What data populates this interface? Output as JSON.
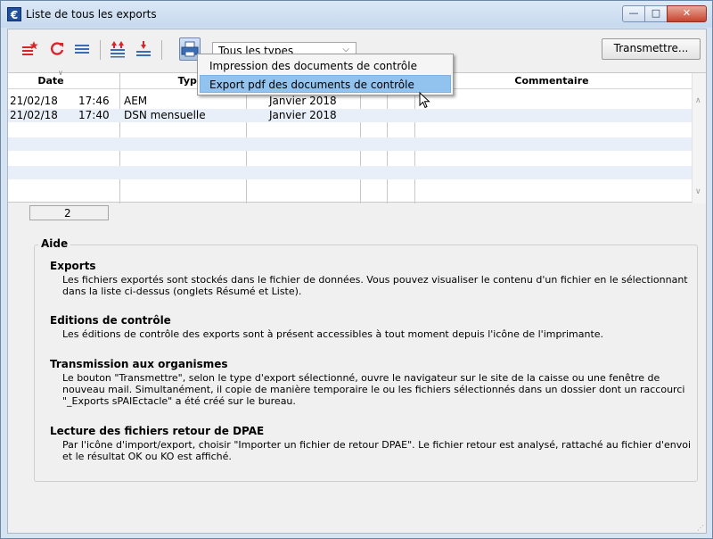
{
  "window": {
    "title": "Liste de tous les exports",
    "app_icon": "€",
    "minimize_glyph": "—",
    "maximize_glyph": "□",
    "close_glyph": "✕"
  },
  "toolbar": {
    "icons": [
      "new-star-icon",
      "refresh-icon",
      "list-icon",
      "sort-up-icon",
      "sort-down-icon",
      "printer-icon"
    ],
    "type_filter_value": "Tous les types",
    "transmit_label": "Transmettre..."
  },
  "menu": {
    "items": [
      {
        "label": "Impression des documents de contrôle",
        "highlighted": false
      },
      {
        "label": "Export pdf des documents de contrôle",
        "highlighted": true
      }
    ]
  },
  "table": {
    "headers": [
      "Date",
      "Type",
      "",
      "",
      "",
      "Commentaire"
    ],
    "rows": [
      {
        "date": "21/02/18",
        "time": "17:46",
        "type": "AEM",
        "period": "Janvier 2018"
      },
      {
        "date": "21/02/18",
        "time": "17:40",
        "type": "DSN mensuelle",
        "period": "Janvier 2018"
      }
    ],
    "count": "2"
  },
  "help": {
    "title": "Aide",
    "sections": [
      {
        "heading": "Exports",
        "text": "Les fichiers exportés sont stockés dans le fichier de données. Vous pouvez visualiser le contenu d'un fichier en le sélectionnant dans la liste ci-dessus (onglets Résumé et Liste)."
      },
      {
        "heading": "Editions de contrôle",
        "text": "Les éditions de contrôle des exports sont à présent accessibles à tout moment depuis l'icône de l'imprimante."
      },
      {
        "heading": "Transmission aux organismes",
        "text": "Le bouton \"Transmettre\", selon le type d'export sélectionné, ouvre le navigateur sur le site de la caisse ou une fenêtre de nouveau mail. Simultanément, il copie de manière temporaire le ou les fichiers sélectionnés dans un dossier dont un raccourci \"_Exports sPAIEctacle\" a été créé sur le bureau."
      },
      {
        "heading": "Lecture des fichiers retour de DPAE",
        "text": "Par l'icône d'import/export, choisir \"Importer un fichier de retour DPAE\". Le fichier retour est analysé, rattaché au fichier d'envoi et le résultat OK ou KO est affiché."
      }
    ]
  },
  "colors": {
    "row_alt": "#e8eff8",
    "menu_highlight": "#92c2ee",
    "icon_red": "#d7262b",
    "icon_blue": "#3a6db5"
  }
}
